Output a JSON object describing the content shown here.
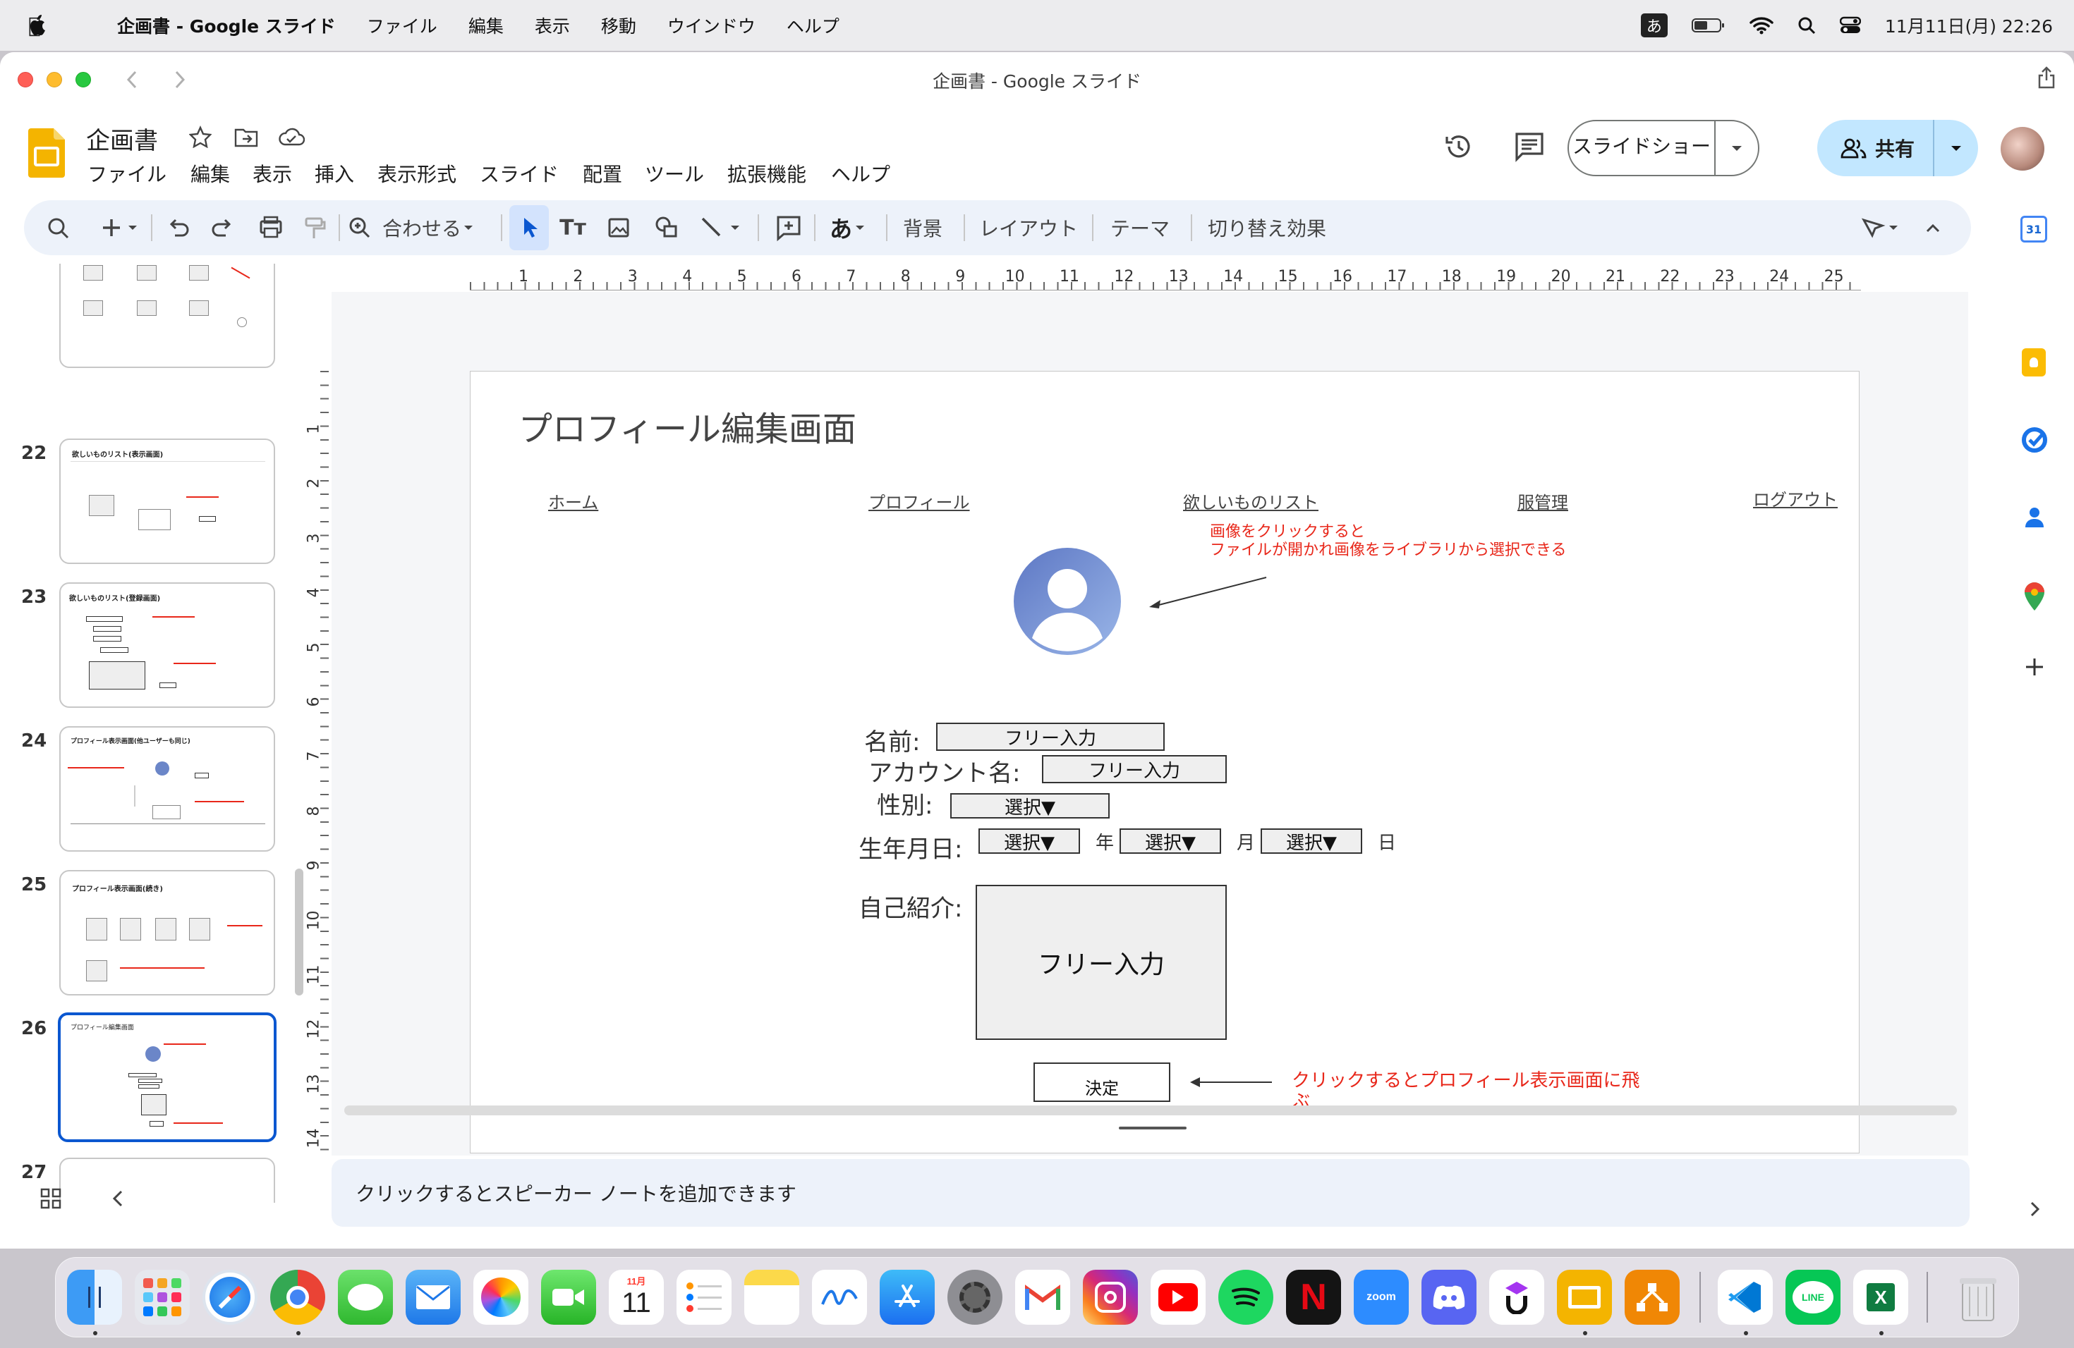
{
  "menubar": {
    "app": "企画書 - Google スライド",
    "items": [
      "ファイル",
      "編集",
      "表示",
      "移動",
      "ウインドウ",
      "ヘルプ"
    ],
    "ime": "あ",
    "datetime": "11月11日(月)  22:26"
  },
  "window": {
    "title": "企画書 - Google スライド"
  },
  "doc": {
    "name": "企画書",
    "menus": [
      "ファイル",
      "編集",
      "表示",
      "挿入",
      "表示形式",
      "スライド",
      "配置",
      "ツール",
      "拡張機能",
      "ヘルプ"
    ],
    "slideshow_label": "スライドショー",
    "share_label": "共有"
  },
  "toolbar": {
    "zoom_label": "合わせる",
    "ime_label": "あ",
    "background": "背景",
    "layout": "レイアウト",
    "theme": "テーマ",
    "transition": "切り替え効果"
  },
  "filmstrip": {
    "slides": [
      {
        "num": "22",
        "title": "欲しいものリスト(表示画面)"
      },
      {
        "num": "23",
        "title": "欲しいものリスト(登録画面)"
      },
      {
        "num": "24",
        "title": "プロフィール表示画面(他ユーザーも同じ)"
      },
      {
        "num": "25",
        "title": "プロフィール表示画面(続き)"
      },
      {
        "num": "26",
        "title": "プロフィール編集画面"
      },
      {
        "num": "27",
        "title": ""
      }
    ]
  },
  "ruler": {
    "h": [
      "1",
      "2",
      "3",
      "4",
      "5",
      "6",
      "7",
      "8",
      "9",
      "10",
      "11",
      "12",
      "13",
      "14",
      "15",
      "16",
      "17",
      "18",
      "19",
      "20",
      "21",
      "22",
      "23",
      "24",
      "25"
    ],
    "v": [
      "1",
      "2",
      "3",
      "4",
      "5",
      "6",
      "7",
      "8",
      "9",
      "10",
      "11",
      "12",
      "13",
      "14"
    ]
  },
  "slide": {
    "title": "プロフィール編集画面",
    "nav": [
      "ホーム",
      "プロフィール",
      "欲しいものリスト",
      "服管理",
      "ログアウト"
    ],
    "note_avatar_1": "画像をクリックすると",
    "note_avatar_2": "ファイルが開かれ画像をライブラリから選択できる",
    "name_label": "名前:",
    "name_field": "フリー入力",
    "account_label": "アカウント名:",
    "account_field": "フリー入力",
    "gender_label": "性別:",
    "gender_select": "選択▼",
    "birth_label": "生年月日:",
    "year_select": "選択▼",
    "year_unit": "年",
    "month_select": "選択▼",
    "month_unit": "月",
    "day_select": "選択▼",
    "day_unit": "日",
    "bio_label": "自己紹介:",
    "bio_field": "フリー入力",
    "submit": "決定",
    "note_submit_1": "クリックするとプロフィール表示画面に飛",
    "note_submit_2": "ぶ"
  },
  "notes": {
    "placeholder": "クリックするとスピーカー ノートを追加できます"
  },
  "dock": {
    "calendar_month": "11月",
    "calendar_day": "11",
    "zoom": "zoom",
    "netflix": "N",
    "line": "LINE",
    "excel": "X"
  },
  "colors": {
    "accent": "#0b57d0",
    "share_bg": "#c2e7ff",
    "annotation_red": "#e8271a",
    "toolbar_bg": "#edf2fa"
  }
}
